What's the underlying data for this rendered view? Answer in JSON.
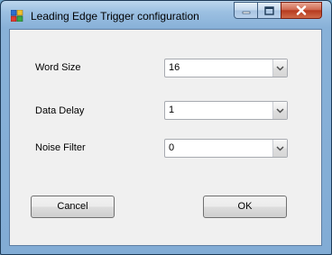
{
  "window": {
    "title": "Leading Edge Trigger configuration",
    "icon": "app-icon",
    "controls": [
      "minimize-icon",
      "maximize-icon",
      "close-icon"
    ],
    "accent": "#82acd5"
  },
  "form": {
    "word_size": {
      "label": "Word Size",
      "value": "16"
    },
    "data_delay": {
      "label": "Data Delay",
      "value": "1"
    },
    "noise_filter": {
      "label": "Noise Filter",
      "value": "0"
    }
  },
  "buttons": {
    "cancel": "Cancel",
    "ok": "OK"
  }
}
